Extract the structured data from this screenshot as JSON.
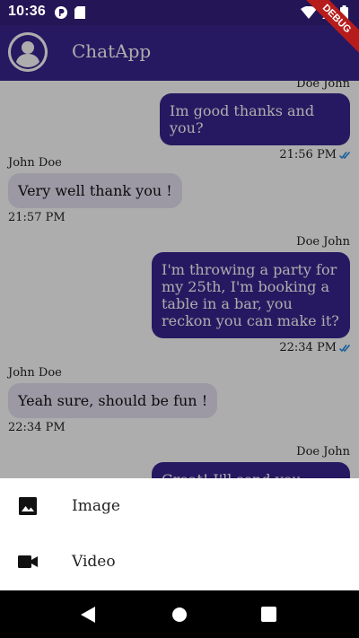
{
  "status_bar": {
    "time": "10:36"
  },
  "app_bar": {
    "title": "ChatApp"
  },
  "debug_banner": "DEBUG",
  "messages": [
    {
      "sender": "Doe John",
      "text": "",
      "time": "",
      "mine": true
    },
    {
      "sender": "",
      "text": "Im good thanks and you?",
      "time": "21:56 PM",
      "mine": true
    },
    {
      "sender": "John Doe",
      "text": "Very well thank you !",
      "time": "21:57 PM",
      "mine": false
    },
    {
      "sender": "Doe John",
      "text": "I'm throwing a party for my 25th, I'm booking a table in a bar, you reckon you can make it?",
      "time": "22:34 PM",
      "mine": true
    },
    {
      "sender": "John Doe",
      "text": "Yeah sure, should be fun !",
      "time": "22:34 PM",
      "mine": false
    },
    {
      "sender": "Doe John",
      "text": "Great! I'll send you the...",
      "time": "",
      "mine": true
    }
  ],
  "sheet": {
    "items": [
      {
        "label": "Image",
        "icon": "image-icon"
      },
      {
        "label": "Video",
        "icon": "video-icon"
      }
    ]
  },
  "colors": {
    "primary": "#3a2690",
    "status": "#241656",
    "bubble_other": "#e6e2f2",
    "check": "#1e88e5"
  }
}
